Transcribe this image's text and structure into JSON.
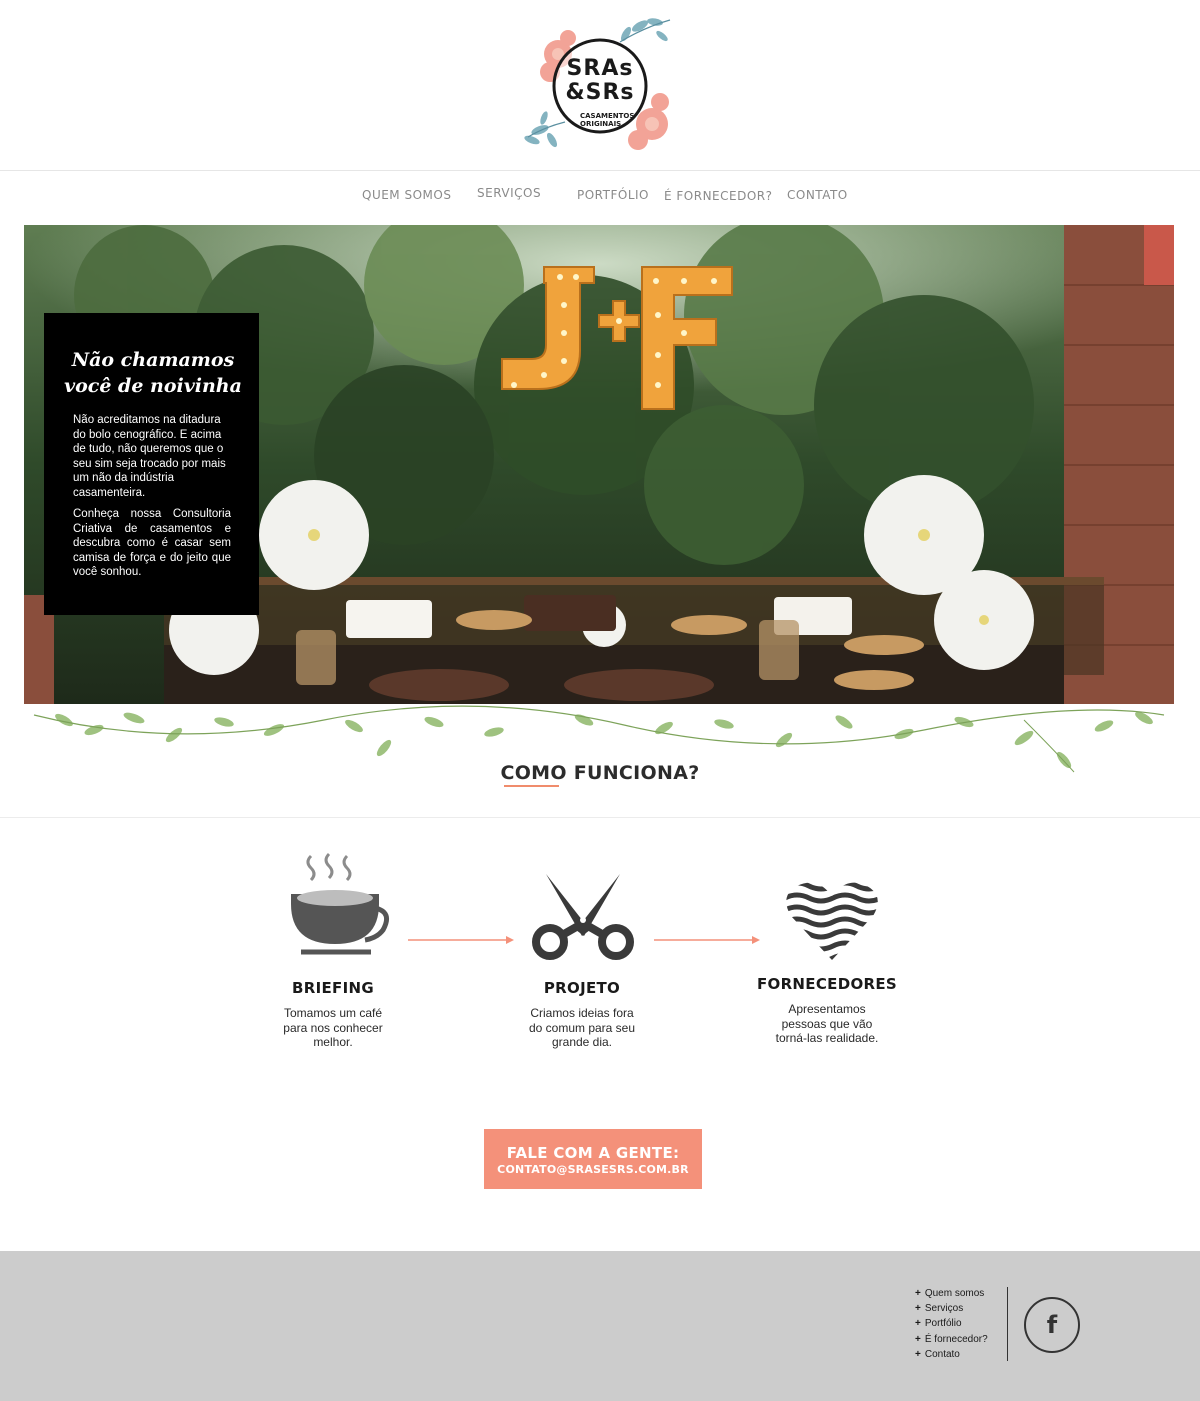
{
  "brand": {
    "logo_line1": "SRAs",
    "logo_line2": "&SRs",
    "logo_tagline": "CASAMENTOS ORIGINAIS",
    "accent_color": "#f4917a"
  },
  "nav": {
    "items": [
      {
        "label": "QUEM SOMOS"
      },
      {
        "label": "SERVIÇOS"
      },
      {
        "label": "PORTFÓLIO"
      },
      {
        "label": "É FORNECEDOR?"
      },
      {
        "label": "CONTATO"
      }
    ]
  },
  "hero": {
    "sign_text": "J+F",
    "title": "Não chamamos você de noivinha",
    "paragraph1": "Não acreditamos na ditadura do bolo cenográfico. E acima de tudo, não queremos que o seu sim seja trocado por mais um não da indústria casamenteira.",
    "paragraph2": "Conheça nossa Consultoria Criativa de casamentos e descubra como é casar sem camisa de força e do jeito que você sonhou."
  },
  "section": {
    "title": "COMO FUNCIONA?"
  },
  "steps": [
    {
      "icon": "coffee-cup-icon",
      "title": "BRIEFING",
      "description": "Tomamos um café para nos conhecer melhor."
    },
    {
      "icon": "scissors-icon",
      "title": "PROJETO",
      "description": "Criamos ideias fora do comum para seu grande dia."
    },
    {
      "icon": "heart-icon",
      "title": "FORNECEDORES",
      "description": "Apresentamos pessoas que vão torná-las realidade."
    }
  ],
  "cta": {
    "line1": "FALE COM A GENTE:",
    "line2": "CONTATO@SRASESRS.COM.BR"
  },
  "footer": {
    "links": [
      {
        "label": "Quem somos"
      },
      {
        "label": "Serviços"
      },
      {
        "label": "Portfólio"
      },
      {
        "label": "É fornecedor?"
      },
      {
        "label": "Contato"
      }
    ],
    "social_icon": "facebook-icon"
  }
}
